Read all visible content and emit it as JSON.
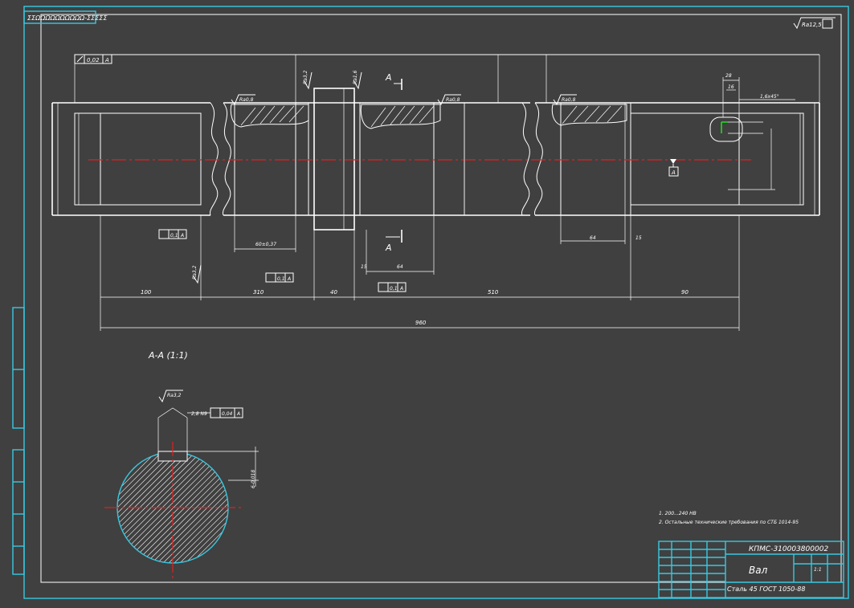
{
  "drawing": {
    "stamp_top_left": "ΣΣΩΩΩΩΩΩΩΩΩΩ-ΣΣΣΣΣ",
    "roughness_general": "Ra12,5",
    "designation": "КПМС-310003800002",
    "title": "Вал",
    "material": "Сталь 45 ГОСТ 1050-88",
    "scale": "1:1"
  },
  "labels": {
    "section_mark_top": "А",
    "section_mark_bottom": "А",
    "section_title": "А-А (1:1)",
    "note_1": "1. 200...240 НВ",
    "note_2": "2. Остальные технические требования по СТБ 1014-95"
  },
  "dimensions": {
    "d100": "100",
    "d310a": "310",
    "d40": "40",
    "d510": "510",
    "d90": "90",
    "total": "960",
    "key_60": "60±0,37",
    "key_64a": "64",
    "key_64b": "64",
    "gap_15": "15",
    "gap_15b": "15",
    "right_28": "28",
    "right_chamfer": "1,6x45°",
    "section_key": "2,8 N9",
    "section_depth": "6-0,018"
  },
  "tolerances": {
    "runout_top": "0,02",
    "perp_1": "0,1",
    "perp_2": "0,1",
    "perp_3": "0,1",
    "sym": "0,04"
  },
  "roughness": {
    "r1": "Ra0,8",
    "r2": "Ra3,2",
    "r3": "Ra1,6",
    "r4": "Ra0,8",
    "r5": "Ra0,8",
    "r6": "Ra3,2"
  }
}
